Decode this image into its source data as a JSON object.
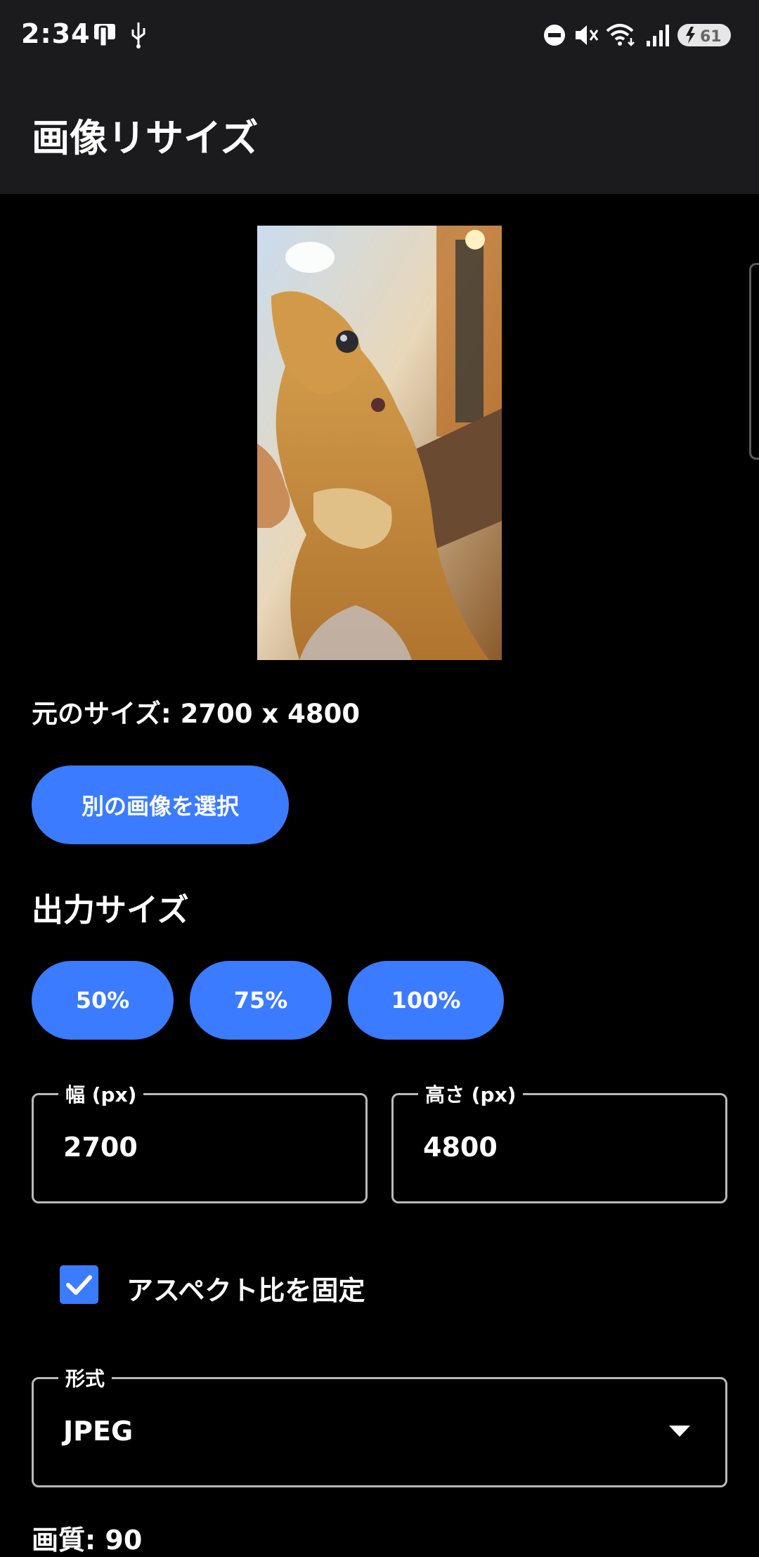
{
  "status_bar": {
    "time": "2:34",
    "battery_level": "61",
    "icons": [
      "phone-icon",
      "usb-icon",
      "dnd-icon",
      "mute-icon",
      "wifi-icon",
      "signal-icon",
      "battery-icon"
    ]
  },
  "app": {
    "title": "画像リサイズ"
  },
  "preview": {
    "alt": "bearded dragon photo"
  },
  "original": {
    "size_text": "元のサイズ: 2700 x 4800"
  },
  "actions": {
    "select_other_image": "別の画像を選択"
  },
  "output": {
    "section_title": "出力サイズ",
    "presets": [
      "50%",
      "75%",
      "100%"
    ],
    "width_label": "幅 (px)",
    "width_value": "2700",
    "height_label": "高さ (px)",
    "height_value": "4800",
    "lock_aspect_label": "アスペクト比を固定",
    "lock_aspect_checked": true
  },
  "format": {
    "label": "形式",
    "value": "JPEG"
  },
  "quality": {
    "text": "画質: 90"
  },
  "colors": {
    "accent": "#3b7bff",
    "bar_bg": "#1b1b1d",
    "background": "#000000"
  }
}
